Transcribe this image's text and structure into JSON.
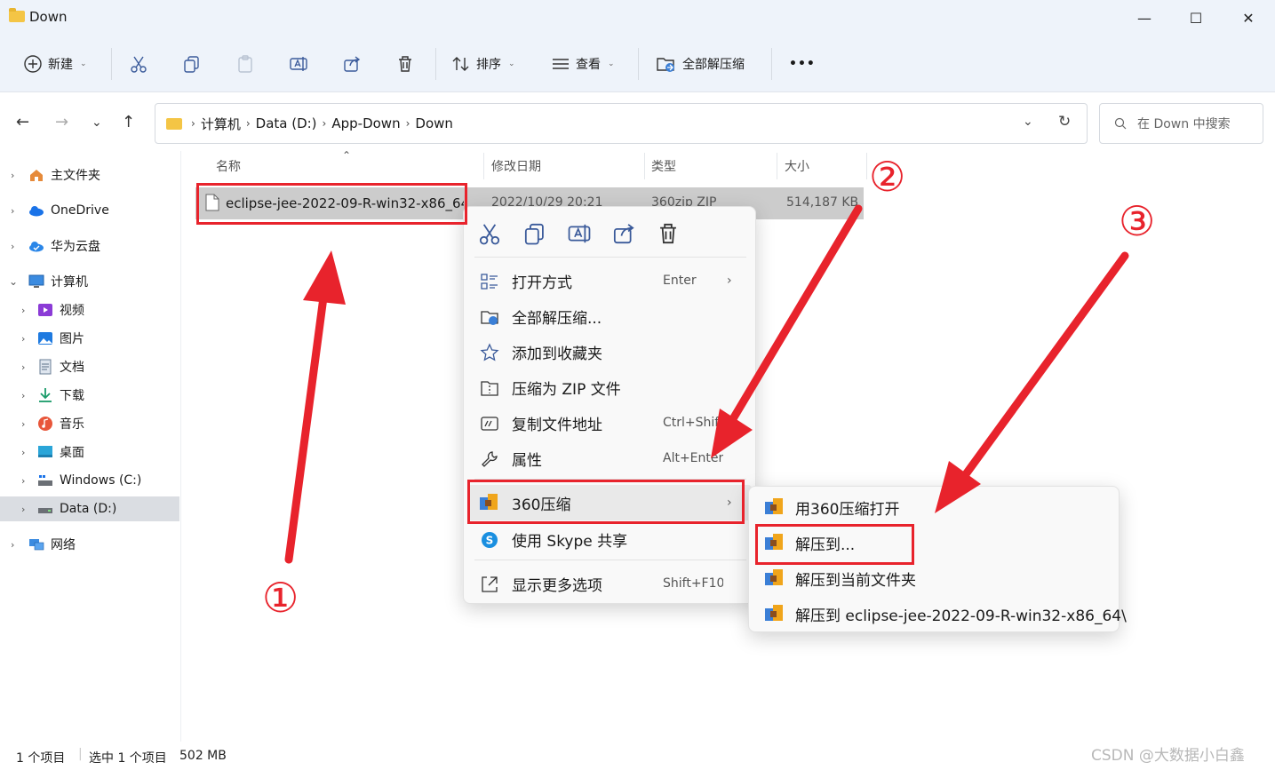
{
  "window": {
    "title": "Down",
    "minimize": "—",
    "maximize": "☐",
    "close": "✕"
  },
  "toolbar": {
    "new_label": "新建",
    "sort_label": "排序",
    "view_label": "查看",
    "extract_all_label": "全部解压缩",
    "more_label": "•••"
  },
  "address": {
    "crumbs": [
      "计算机",
      "Data (D:)",
      "App-Down",
      "Down"
    ],
    "search_placeholder": "在 Down 中搜索"
  },
  "sidebar": {
    "items": [
      {
        "label": "主文件夹"
      },
      {
        "label": "OneDrive"
      },
      {
        "label": "华为云盘"
      },
      {
        "label": "计算机"
      },
      {
        "label": "视频"
      },
      {
        "label": "图片"
      },
      {
        "label": "文档"
      },
      {
        "label": "下载"
      },
      {
        "label": "音乐"
      },
      {
        "label": "桌面"
      },
      {
        "label": "Windows (C:)"
      },
      {
        "label": "Data (D:)"
      },
      {
        "label": "网络"
      }
    ]
  },
  "columns": {
    "name": "名称",
    "modified": "修改日期",
    "type": "类型",
    "size": "大小"
  },
  "file": {
    "name": "eclipse-jee-2022-09-R-win32-x86_64",
    "modified": "2022/10/29 20:21",
    "type": "360zip ZIP",
    "size": "514,187 KB"
  },
  "context_menu": {
    "items": [
      {
        "label": "打开方式",
        "shortcut": "Enter"
      },
      {
        "label": "全部解压缩...",
        "shortcut": ""
      },
      {
        "label": "添加到收藏夹",
        "shortcut": ""
      },
      {
        "label": "压缩为 ZIP 文件",
        "shortcut": ""
      },
      {
        "label": "复制文件地址",
        "shortcut": "Ctrl+Shift+C"
      },
      {
        "label": "属性",
        "shortcut": "Alt+Enter"
      },
      {
        "label": "360压缩",
        "shortcut": ""
      },
      {
        "label": "使用 Skype 共享",
        "shortcut": ""
      },
      {
        "label": "显示更多选项",
        "shortcut": "Shift+F10"
      }
    ]
  },
  "submenu": {
    "items": [
      {
        "label": "用360压缩打开"
      },
      {
        "label": "解压到..."
      },
      {
        "label": "解压到当前文件夹"
      },
      {
        "label": "解压到 eclipse-jee-2022-09-R-win32-x86_64\\"
      }
    ]
  },
  "annotations": {
    "n1": "①",
    "n2": "②",
    "n3": "③"
  },
  "status": {
    "count": "1 个项目",
    "selected": "选中 1 个项目",
    "size": "502 MB"
  },
  "watermark": "CSDN @大数据小白鑫",
  "colors": {
    "accent": "#e8232c",
    "selected_row": "#cccccc",
    "chrome_bg": "#eef3fa"
  }
}
